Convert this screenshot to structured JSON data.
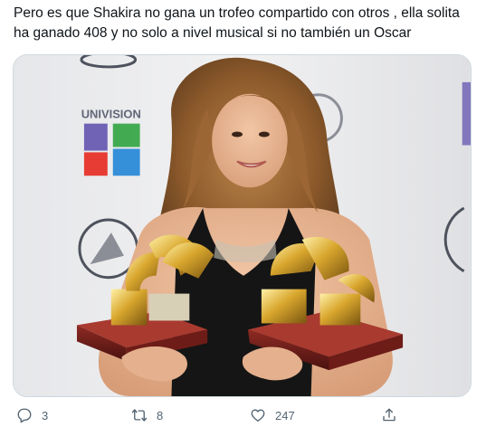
{
  "tweet": {
    "text": "Pero es que Shakira no gana un trofeo compartido con otros , ella solita ha ganado 408 y no solo a nivel musical si no también un Oscar"
  },
  "media": {
    "backdrop_text": "UNIVISION",
    "description_icon": "photo"
  },
  "actions": {
    "reply_count": "3",
    "retweet_count": "8",
    "like_count": "247"
  },
  "icons": {
    "reply": "reply-icon",
    "retweet": "retweet-icon",
    "like": "heart-icon",
    "share": "share-icon"
  },
  "colors": {
    "text": "#0f1419",
    "muted": "#536471",
    "border": "#cfd9de"
  }
}
